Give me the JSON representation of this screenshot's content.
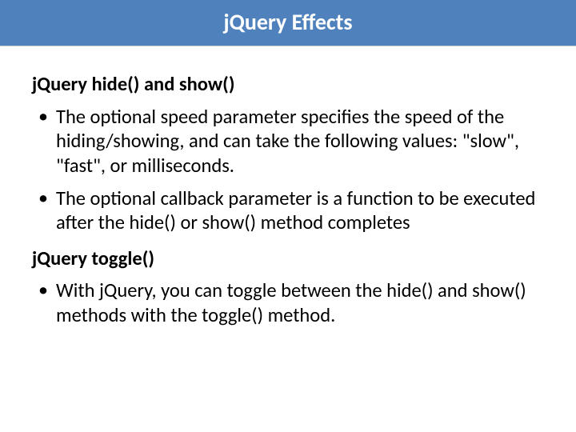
{
  "header": {
    "title": "jQuery Effects"
  },
  "sections": [
    {
      "title": "jQuery hide() and show()",
      "bullets": [
        "The optional speed parameter specifies the speed of the hiding/showing, and can take the following values: \"slow\", \"fast\", or milliseconds.",
        "The optional callback parameter is a function to be executed after the hide() or show() method completes"
      ]
    },
    {
      "title": "jQuery toggle()",
      "bullets": [
        "With jQuery, you can toggle between the hide() and show() methods with the toggle() method."
      ]
    }
  ]
}
